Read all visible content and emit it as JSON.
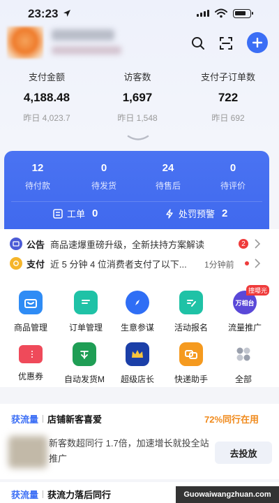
{
  "status_bar": {
    "time": "23:23"
  },
  "stats": [
    {
      "label": "支付金额",
      "value": "4,188.48",
      "yesterday": "昨日 4,023.7"
    },
    {
      "label": "访客数",
      "value": "1,697",
      "yesterday": "昨日 1,548"
    },
    {
      "label": "支付子订单数",
      "value": "722",
      "yesterday": "昨日 692"
    }
  ],
  "orders": [
    {
      "count": "12",
      "label": "待付款"
    },
    {
      "count": "0",
      "label": "待发货"
    },
    {
      "count": "24",
      "label": "待售后"
    },
    {
      "count": "0",
      "label": "待评价"
    }
  ],
  "work_order": {
    "label": "工单",
    "count": "0"
  },
  "penalty": {
    "label": "处罚预警",
    "count": "2"
  },
  "notices": {
    "announcement": {
      "tag": "公告",
      "text": "商品速爆重磅升级，全新扶持方案解读",
      "badge": "2"
    },
    "payment": {
      "tag": "支付",
      "text": "近 5 分钟 4 位消费者支付了以下...",
      "time": "1分钟前"
    }
  },
  "tools": [
    {
      "label": "商品管理",
      "icon": "shopping-bag-icon",
      "color": "#2f8cf5"
    },
    {
      "label": "订单管理",
      "icon": "order-doc-icon",
      "color": "#1fc2a6"
    },
    {
      "label": "生意参谋",
      "icon": "compass-icon",
      "color": "#2f6ef5"
    },
    {
      "label": "活动报名",
      "icon": "edit-doc-icon",
      "color": "#1fc2a6"
    },
    {
      "label": "流量推广",
      "icon": "wanxiangtai-icon",
      "color": "#5a48d8",
      "badge": "撞曝光",
      "logo_text": "万相台"
    },
    {
      "label": "优惠券",
      "icon": "coupon-icon",
      "color": "#ef4a5a"
    },
    {
      "label": "自动发货M",
      "icon": "auto-ship-icon",
      "color": "#1f9e55"
    },
    {
      "label": "超级店长",
      "icon": "crown-icon",
      "color": "#1b3fa8"
    },
    {
      "label": "快递助手",
      "icon": "express-icon",
      "color": "#f59a1f"
    },
    {
      "label": "全部",
      "icon": "all-grid-icon",
      "color": "#9aa0ad"
    }
  ],
  "traffic_card": {
    "tag": "获流量",
    "title": "店铺新客喜爱",
    "note": "72%同行在用",
    "desc": "新客数超同行 1.7倍，加速增长就投全站推广",
    "action": "去投放"
  },
  "traffic_card2": {
    "tag": "获流量",
    "title": "获流力落后同行"
  },
  "watermark": "Guowaiwangzhuan.com"
}
